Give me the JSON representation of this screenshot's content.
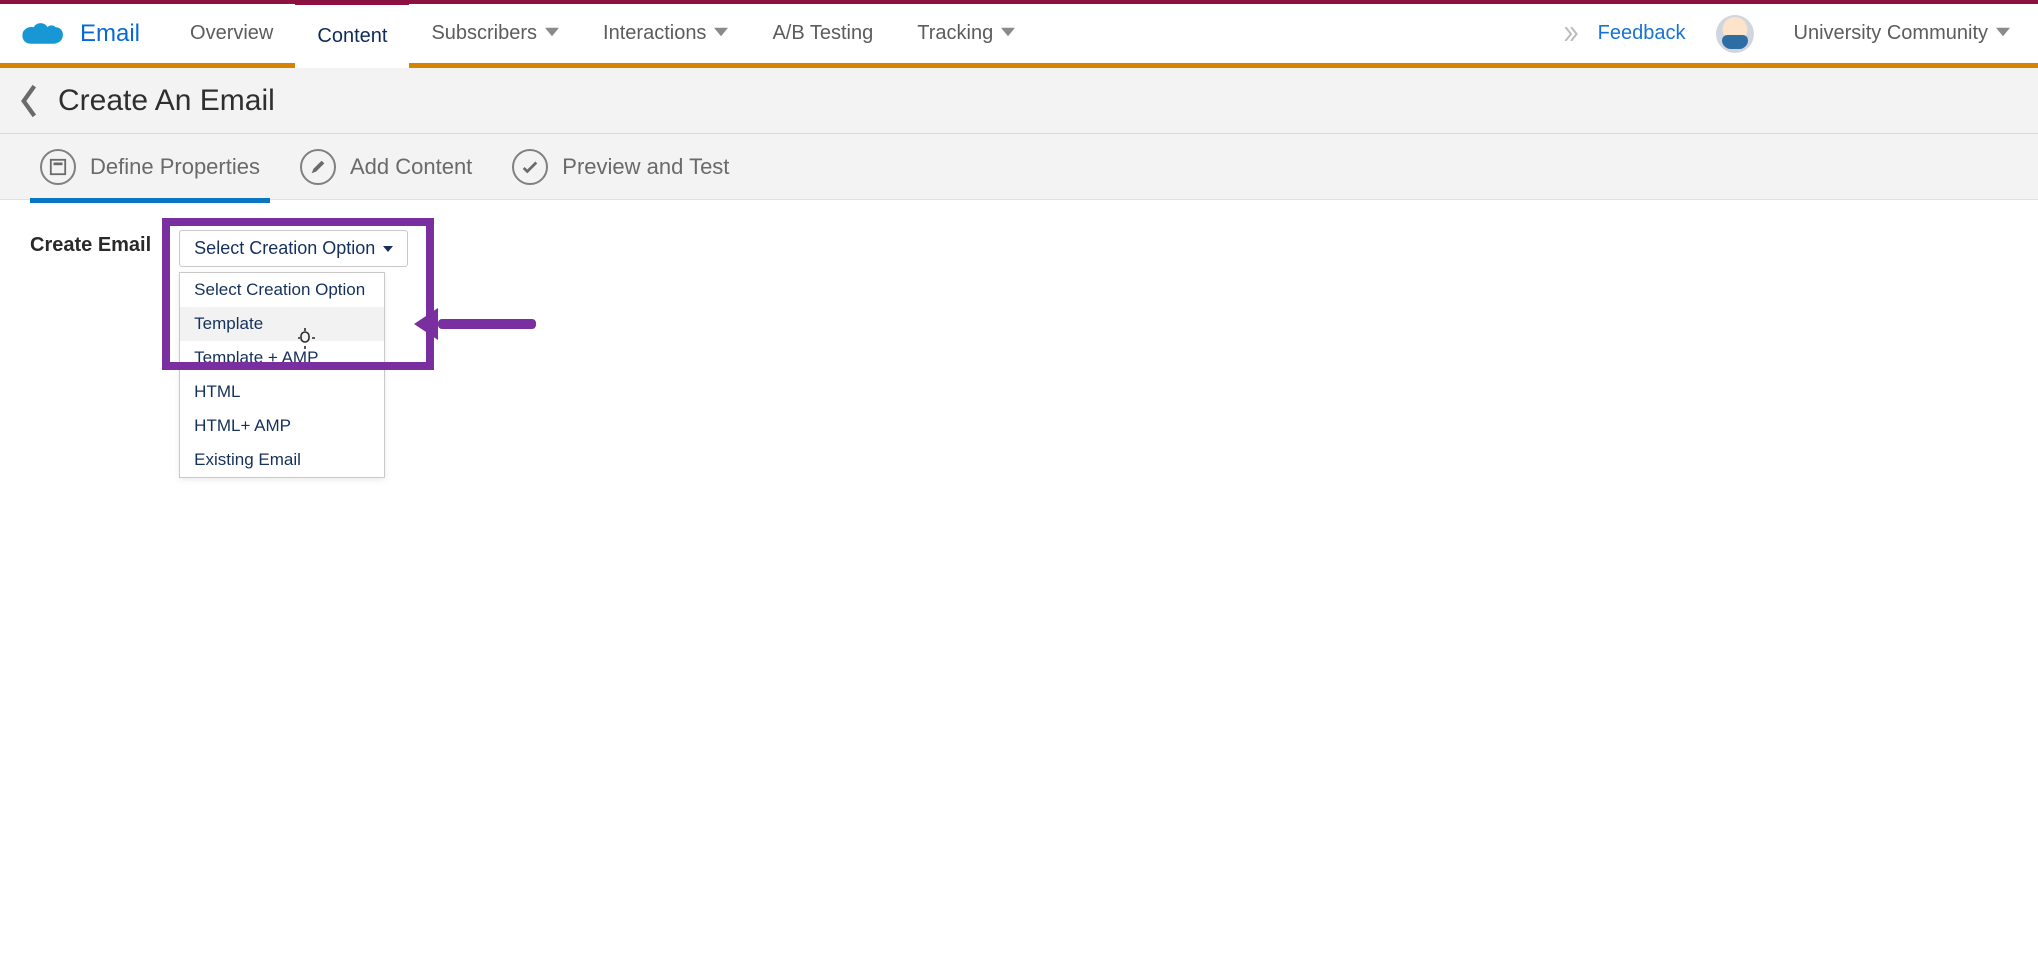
{
  "brand": {
    "label": "Email"
  },
  "nav": {
    "overview": "Overview",
    "content": "Content",
    "subscribers": "Subscribers",
    "interactions": "Interactions",
    "abtesting": "A/B Testing",
    "tracking": "Tracking",
    "feedback": "Feedback",
    "univ": "University Community"
  },
  "subheader": {
    "title": "Create An Email"
  },
  "steps": {
    "s1": "Define Properties",
    "s2": "Add Content",
    "s3": "Preview and Test"
  },
  "form": {
    "create_label": "Create Email",
    "select_button": "Select Creation Option",
    "options": {
      "o0": "Select Creation Option",
      "o1": "Template",
      "o2": "Template + AMP",
      "o3": "HTML",
      "o4": "HTML+ AMP",
      "o5": "Existing Email"
    }
  }
}
